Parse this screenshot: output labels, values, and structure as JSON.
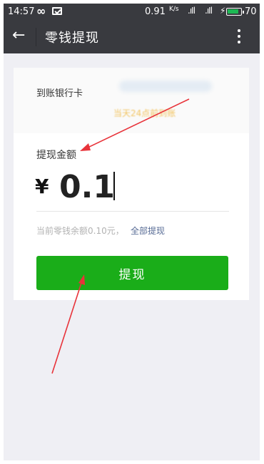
{
  "status_bar": {
    "time": "14:57",
    "speed": "0.91",
    "speed_unit": "K/s",
    "battery_level": "70",
    "icons": [
      "infinity-icon",
      "message-icon",
      "signal-icon",
      "signal-icon",
      "charging-icon",
      "battery-icon"
    ]
  },
  "header": {
    "back_icon": "arrow-left-icon",
    "title": "零钱提现",
    "more_icon": "more-vertical-icon"
  },
  "bank": {
    "label": "到账银行卡",
    "hint": "当天24点前到账"
  },
  "withdraw": {
    "amount_label": "提现金额",
    "currency": "¥",
    "amount": "0.1",
    "balance_text": "当前零钱余额0.10元，",
    "all_link": "全部提现",
    "button_label": "提现"
  },
  "colors": {
    "header_bg": "#393a3f",
    "page_bg": "#efeff4",
    "button": "#1aad19",
    "link": "#576b95",
    "arrow": "#e8333a"
  }
}
